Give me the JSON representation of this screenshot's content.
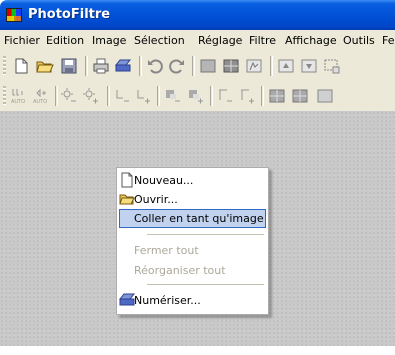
{
  "window": {
    "title": "PhotoFiltre"
  },
  "menubar": {
    "items": [
      "Fichier",
      "Edition",
      "Image",
      "Sélection",
      "Réglage",
      "Filtre",
      "Affichage",
      "Outils",
      "Fe"
    ]
  },
  "toolbar1": {
    "buttons": [
      "new-file-icon",
      "open-folder-icon",
      "save-disk-icon",
      "print-icon",
      "scan-icon",
      "undo-icon",
      "redo-icon",
      "fill-icon",
      "grid-icon",
      "transform-icon",
      "import-icon",
      "export-icon",
      "selection-icon"
    ]
  },
  "toolbar2": {
    "buttons": [
      "auto-levels-icon",
      "auto-contrast-icon",
      "brightness-minus-icon",
      "brightness-plus-icon",
      "contrast-minus-icon",
      "contrast-plus-icon",
      "saturation-minus-icon",
      "saturation-plus-icon",
      "gamma-minus-icon",
      "gamma-plus-icon",
      "filter-a-icon",
      "filter-b-icon",
      "filter-c-icon"
    ],
    "auto_label_1": "AUTO",
    "auto_label_2": "AUTO"
  },
  "context_menu": {
    "new": "Nouveau...",
    "open": "Ouvrir...",
    "paste_as_image": "Coller en tant qu'image",
    "close_all": "Fermer tout",
    "arrange_all": "Réorganiser tout",
    "scan": "Numériser..."
  }
}
